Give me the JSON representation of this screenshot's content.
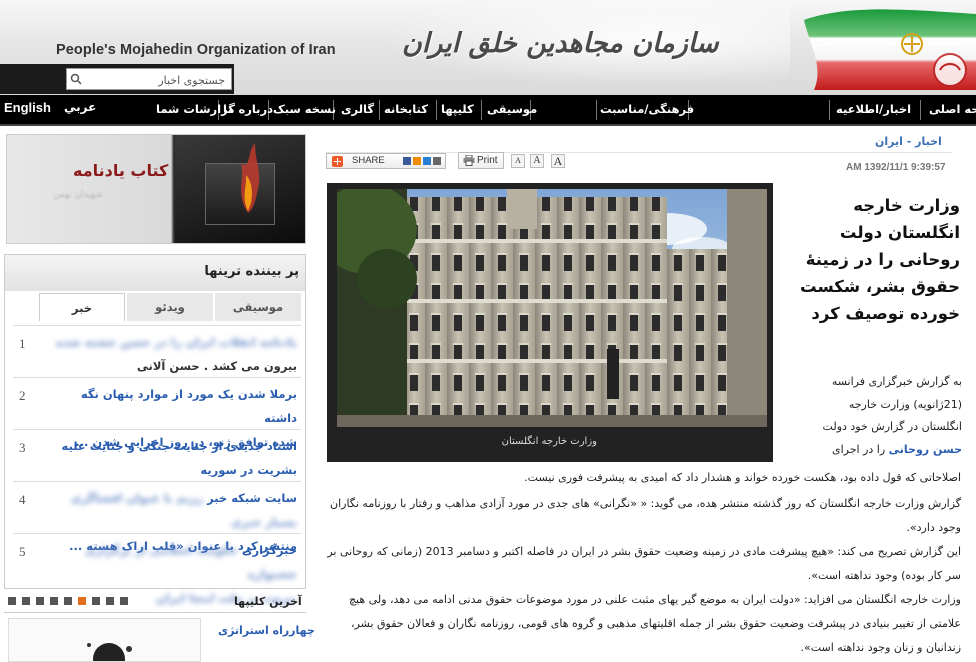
{
  "header": {
    "site_title_en": "People's Mojahedin Organization of Iran",
    "site_title_fa": "سازمان مجاهدین خلق ایران",
    "search_placeholder": "جستجوی اخبار"
  },
  "nav": {
    "items": [
      "صفحه اصلی",
      "اخبار/اطلاعیه",
      "فرهنگی/مناسبت",
      "موسیقی",
      "کلیپها",
      "کتابخانه",
      "گالری",
      "نسخه سبک",
      "درباره ما",
      "گزارشات شما"
    ],
    "english": "English",
    "arabic": "عربي"
  },
  "breadcrumb": "اخبار - ایران",
  "tools": {
    "share_label": "SHARE",
    "print_label": "Print",
    "font_letter": "A"
  },
  "date_stamp": "AM 1392/11/1 9:39:57",
  "article": {
    "headline": "وزارت خارجه انگلستان دولت روحانی را در زمینهٔ حقوق بشر، شکست خورده توصیف کرد",
    "photo_caption": "وزارت خارجه انگلستان",
    "intro_lines": [
      "به گزارش خبرگزاری فرانسه",
      "(21ژانویه) وزارت خارجه",
      "انگلستان در گزارش خود دولت"
    ],
    "intro_link": "حسن روحانی",
    "intro_link_tail": "را در اجرای",
    "p1_tail": "اصلاحاتی که قول داده بود، هکست خورده خواند و هشدار داد که امیدی به پیشرفت فوری نیست.",
    "p2": "گزارش وزارت خارجه انگلستان که روز گذشته منتشر هده، می گوید: « «نگرانی» های جدی در مورد آزادی مذاهب و رفتار با روزنامه نگاران وجود دارد».",
    "p3": "این گزارش تصریح می کند: «هیچ پیشرفت مادی در زمینه وضعیت حقوق بشر در ایران در فاصله اکتبر و دسامبر 2013 (زمانی که روحانی بر سر کار بوده) وجود نداهته است».",
    "p4": "وزارت خارجه انگلستان می افزاید: «دولت ایران به موضع گیر یهای مثبت علنی در مورد موضوعات حقوق مدنی ادامه می دهد، ولی هیچ علامتی از تغییر بنیادی در پیشرفت وضعیت حقوق بشر از جمله اقلیتهای مذهبی و گروه های قومی، روزنامه نگاران و فعالان حقوق بشر، زندانیان و زنان وجود نداهته است»."
  },
  "sidebar": {
    "book_title": "کتاب یادنامه",
    "book_subtitle": "شهیدان بهمن",
    "most_viewed_title": "پر بیننده ترینها",
    "tabs": [
      "موسیقی",
      "ویدئو",
      "خبر"
    ],
    "rows": [
      {
        "num": "1",
        "text_a": "یادنامه انقلاب ایران را در حسن خشته شده",
        "text_b": "بیرون می کشد . حسن آلانی",
        "blurred": true
      },
      {
        "num": "2",
        "text_a": "برملا شدن یک مورد از موارد پنهان نگه داشته",
        "text_b": "شده توافق ژنو، در روز اجرایی شدن ...",
        "blurred": false
      },
      {
        "num": "3",
        "text_a": "اسناد جدیدی از جنایت جنگی و جنایت علیه",
        "text_b": "بشریت در سوریه",
        "blurred": false
      },
      {
        "num": "4",
        "text_a": "سایت شبکه خبر",
        "text_a2": "رژیم با عنوان افشاگری بسیار خبری",
        "text_b": "منتشر کرد با عنوان «قلب اراک هسته ...",
        "blurred": false
      },
      {
        "num": "5",
        "text_a": "خبرگزاری",
        "text_a2": "حکومت اسلامی از برگزاری جشنواره",
        "text_b": "بیروت بر ملت اینجا ایران",
        "blurred": false
      }
    ],
    "clips_title": "آخرین کلیپها",
    "clip_title": "چهارراه استراتژی"
  },
  "colors": {
    "nav_bg": "#000000",
    "link": "#2a5db0",
    "headline": "#111111",
    "pager_active": "#e07020"
  }
}
